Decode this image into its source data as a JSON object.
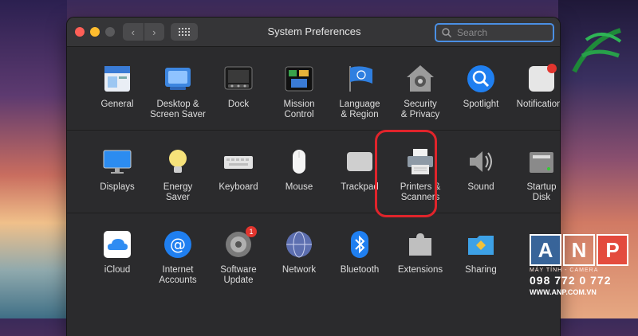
{
  "window": {
    "title": "System Preferences",
    "search_placeholder": "Search",
    "back_glyph": "‹",
    "forward_glyph": "›"
  },
  "rows": [
    [
      {
        "name": "general",
        "label": "General",
        "icon": "general-icon"
      },
      {
        "name": "desktop-screen-saver",
        "label": "Desktop &\nScreen Saver",
        "icon": "desktop-icon"
      },
      {
        "name": "dock",
        "label": "Dock",
        "icon": "dock-icon"
      },
      {
        "name": "mission-control",
        "label": "Mission\nControl",
        "icon": "mission-control-icon"
      },
      {
        "name": "language-region",
        "label": "Language\n& Region",
        "icon": "flag-icon"
      },
      {
        "name": "security-privacy",
        "label": "Security\n& Privacy",
        "icon": "house-lock-icon"
      },
      {
        "name": "spotlight",
        "label": "Spotlight",
        "icon": "magnifier-icon"
      },
      {
        "name": "notifications",
        "label": "Notifications",
        "icon": "notifications-icon"
      }
    ],
    [
      {
        "name": "displays",
        "label": "Displays",
        "icon": "monitor-icon"
      },
      {
        "name": "energy-saver",
        "label": "Energy\nSaver",
        "icon": "lightbulb-icon"
      },
      {
        "name": "keyboard",
        "label": "Keyboard",
        "icon": "keyboard-icon"
      },
      {
        "name": "mouse",
        "label": "Mouse",
        "icon": "mouse-icon"
      },
      {
        "name": "trackpad",
        "label": "Trackpad",
        "icon": "trackpad-icon"
      },
      {
        "name": "printers-scanners",
        "label": "Printers &\nScanners",
        "icon": "printer-icon"
      },
      {
        "name": "sound",
        "label": "Sound",
        "icon": "speaker-icon"
      },
      {
        "name": "startup-disk",
        "label": "Startup\nDisk",
        "icon": "disk-icon"
      }
    ],
    [
      {
        "name": "icloud",
        "label": "iCloud",
        "icon": "cloud-icon"
      },
      {
        "name": "internet-accounts",
        "label": "Internet\nAccounts",
        "icon": "at-sign-icon"
      },
      {
        "name": "software-update",
        "label": "Software\nUpdate",
        "icon": "gear-icon",
        "badge": "1"
      },
      {
        "name": "network",
        "label": "Network",
        "icon": "globe-icon"
      },
      {
        "name": "bluetooth",
        "label": "Bluetooth",
        "icon": "bluetooth-icon"
      },
      {
        "name": "extensions",
        "label": "Extensions",
        "icon": "puzzle-icon"
      },
      {
        "name": "sharing",
        "label": "Sharing",
        "icon": "folder-sign-icon"
      }
    ]
  ],
  "watermark": {
    "letters": [
      "A",
      "N",
      "P"
    ],
    "subtitle": "MÁY TÍNH - CAMERA",
    "phone": "098 772 0 772",
    "url": "WWW.ANP.COM.VN"
  },
  "colors": {
    "accent": "#4a8fe4",
    "highlight": "#e0242b",
    "window_bg": "#2b2b2d"
  }
}
